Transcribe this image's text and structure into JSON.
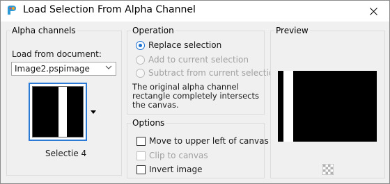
{
  "window": {
    "title": "Load Selection From Alpha Channel"
  },
  "alpha_channels": {
    "legend": "Alpha channels",
    "load_from_label": "Load from document:",
    "document_value": "Image2.pspimage",
    "selected_channel": "Selectie 4"
  },
  "operation": {
    "legend": "Operation",
    "options": [
      {
        "label": "Replace selection",
        "checked": true,
        "enabled": true
      },
      {
        "label": "Add to current selection",
        "checked": false,
        "enabled": false
      },
      {
        "label": "Subtract from current selection",
        "checked": false,
        "enabled": false
      }
    ],
    "info": "The original alpha channel rectangle completely intersects the canvas."
  },
  "options": {
    "legend": "Options",
    "items": [
      {
        "label": "Move to upper left of canvas",
        "checked": false,
        "enabled": true
      },
      {
        "label": "Clip to canvas",
        "checked": false,
        "enabled": false
      },
      {
        "label": "Invert image",
        "checked": false,
        "enabled": true
      }
    ]
  },
  "preview": {
    "legend": "Preview"
  },
  "icons": {
    "app": "paintshop-icon",
    "close": "close-icon",
    "chevron": "chevron-down-icon",
    "dropdown": "triangle-down-icon",
    "checker": "checkerboard-icon"
  },
  "colors": {
    "accent": "#1b6fd0",
    "thumb_border": "#2b7bd6"
  }
}
